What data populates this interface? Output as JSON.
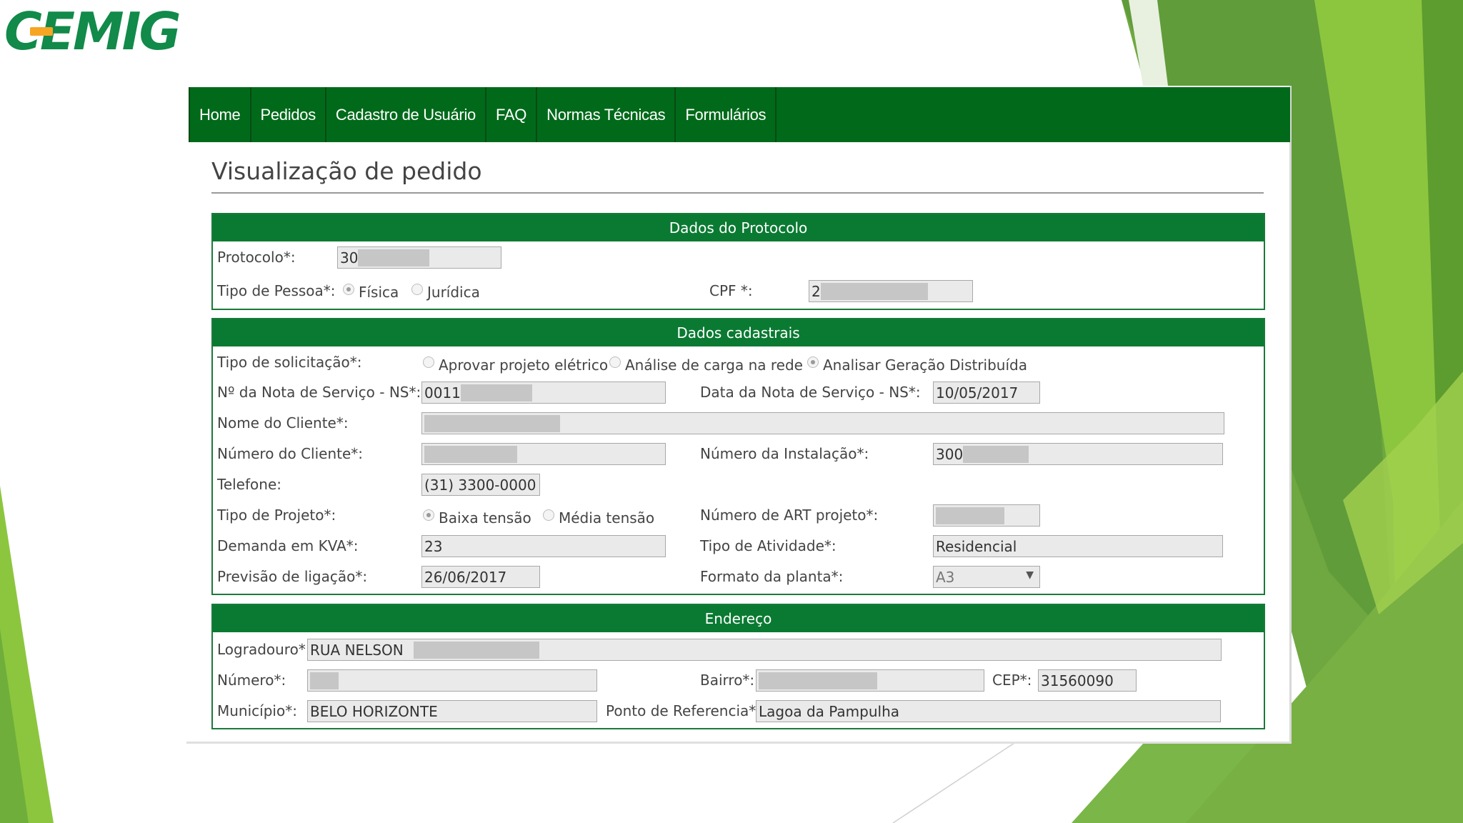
{
  "logo": {
    "text": "CEMIG",
    "c_letter": "C",
    "rest": "EMIG"
  },
  "nav": {
    "items": [
      "Home",
      "Pedidos",
      "Cadastro de Usuário",
      "FAQ",
      "Normas Técnicas",
      "Formulários"
    ]
  },
  "page_title": "Visualização de pedido",
  "protocolo": {
    "header": "Dados do Protocolo",
    "protocolo_label": "Protocolo*:",
    "protocolo_value": "30",
    "tipo_pessoa_label": "Tipo de Pessoa*:",
    "fisica": "Física",
    "juridica": "Jurídica",
    "cpf_label": "CPF *:",
    "cpf_value": "2"
  },
  "cadastrais": {
    "header": "Dados cadastrais",
    "tipo_solicitacao_label": "Tipo de solicitação*:",
    "opt_aprovar": "Aprovar projeto elétrico",
    "opt_analise": "Análise de carga na rede",
    "opt_geracao": "Analisar Geração Distribuída",
    "nota_label": "Nº da Nota de Serviço - NS*:",
    "nota_value": "0011",
    "data_nota_label": "Data da Nota de Serviço - NS*:",
    "data_nota_value": "10/05/2017",
    "nome_label": "Nome do Cliente*:",
    "numero_cliente_label": "Número do Cliente*:",
    "instalacao_label": "Número da Instalação*:",
    "instalacao_value": "300",
    "telefone_label": "Telefone:",
    "telefone_value": "(31) 3300-0000",
    "tipo_projeto_label": "Tipo de Projeto*:",
    "opt_baixa": "Baixa tensão",
    "opt_media": "Média tensão",
    "art_label": "Número de ART projeto*:",
    "demanda_label": "Demanda em KVA*:",
    "demanda_value": "23",
    "atividade_label": "Tipo de Atividade*:",
    "atividade_value": "Residencial",
    "previsao_label": "Previsão de ligação*:",
    "previsao_value": "26/06/2017",
    "formato_label": "Formato da planta*:",
    "formato_value": "A3"
  },
  "endereco": {
    "header": "Endereço",
    "logradouro_label": "Logradouro*:",
    "logradouro_value": "RUA NELSON",
    "numero_label": "Número*:",
    "bairro_label": "Bairro*:",
    "cep_label": "CEP*:",
    "cep_value": "31560090",
    "municipio_label": "Município*:",
    "municipio_value": "BELO HORIZONTE",
    "ponto_label": "Ponto de Referencia*:",
    "ponto_value": "Lagoa da Pampulha"
  },
  "colors": {
    "nav_green": "#006a1a",
    "section_green": "#0a7a32",
    "logo_green": "#118a4a",
    "logo_accent": "#f6a623",
    "slide_green": "#7ab648"
  }
}
